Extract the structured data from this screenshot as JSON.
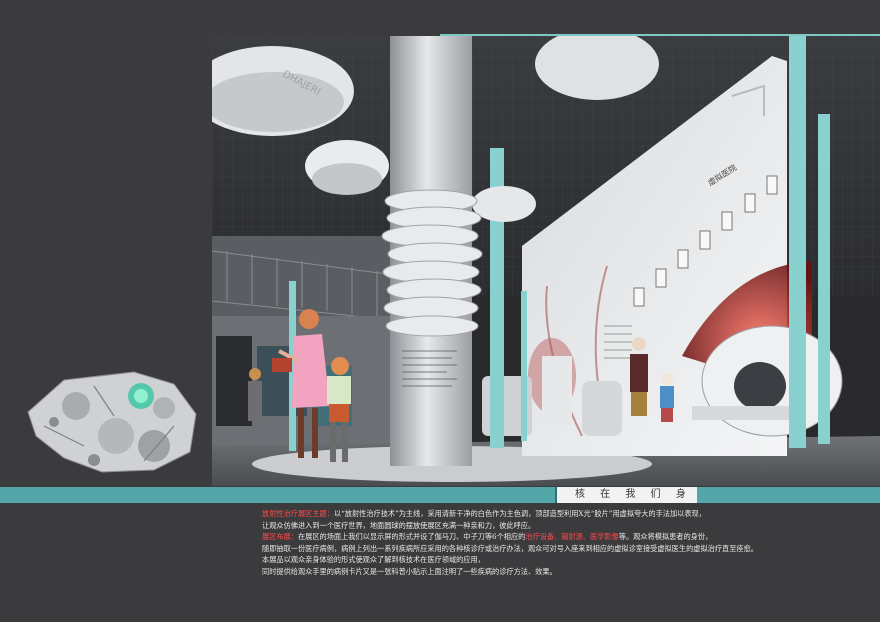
{
  "section_title": "核 在 我 们 身 边",
  "sign": {
    "hospital_label": "虚拟医院",
    "wall_text": "DHAJERI"
  },
  "paragraphs": [
    {
      "lead": "放射性治疗展区主题：",
      "text": "以“放射性治疗技术”为主线，采用清新干净的白色作为主色调，顶部造型利用X光“胶片”用虚拟夸大的手法加以表现，"
    },
    {
      "lead": "",
      "text": "让观众仿佛进入到一个医疗世界，地面圆球的摆放使展区充满一种亲和力，彼此呼应。"
    },
    {
      "lead": "展区布展：",
      "text": "在展区的场面上我们以显示屏的形式并设了伽马刀、中子刀等6个相应的",
      "hl": "治疗设备、辐射源、医学影像",
      "tail": "等。观众将模拟患者的身份，"
    },
    {
      "lead": "",
      "text": "随即抽取一份医疗病例，病例上列出一系列疾病所应采用的各种核诊疗或治疗办法，观众可对号入座来到相应的虚拟诊室接受虚拟医生的虚拟治疗直至痊愈。"
    },
    {
      "lead": "",
      "text": "本展品以观众亲身体验的形式使观众了解到核技术在医疗领域的应用，"
    },
    {
      "lead": "",
      "text": "同时提供给观众手里的病例卡片又是一张科普小贴示上面注明了一些疾病的诊疗方法、效果。"
    }
  ],
  "colors": {
    "teal": "#54a7a8",
    "highlight": "#ff4a4a",
    "background": "#3b3b3d"
  }
}
